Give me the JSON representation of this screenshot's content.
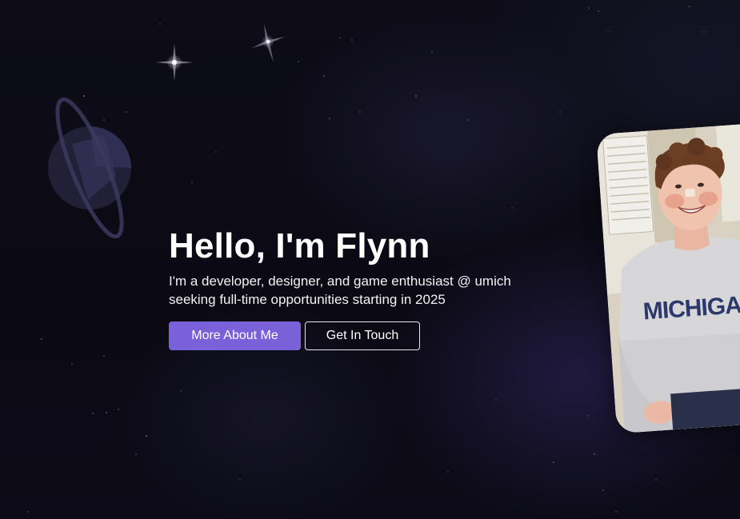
{
  "hero": {
    "headline": "Hello, I'm Flynn",
    "tagline_line1": "I'm a developer, designer, and game enthusiast @ umich",
    "tagline_line2": "seeking full-time opportunities starting in 2025",
    "primary_button_label": "More About Me",
    "secondary_button_label": "Get In Touch"
  },
  "photo": {
    "shirt_text": "MICHIGAN"
  },
  "colors": {
    "background": "#0b0a14",
    "accent": "#7b61d9",
    "text": "#ffffff"
  },
  "icons": [
    "planet-icon",
    "sparkle-icon"
  ]
}
